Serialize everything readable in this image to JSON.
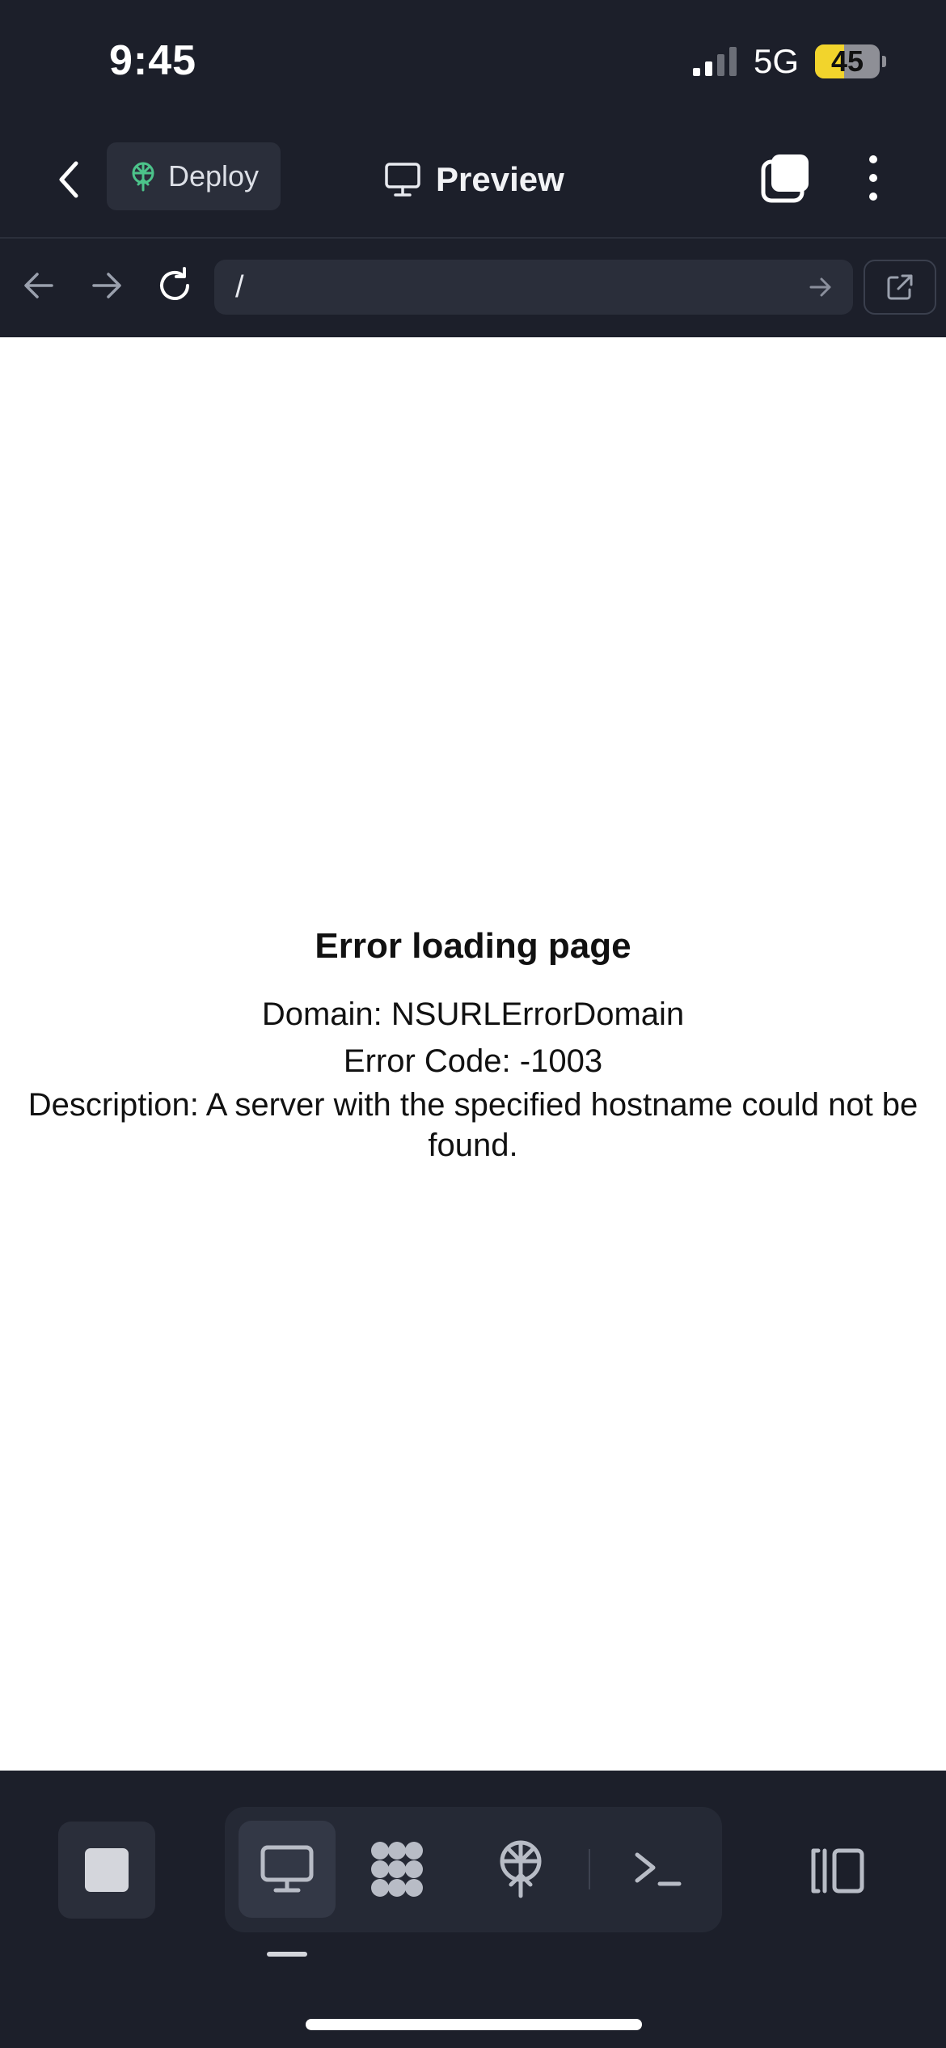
{
  "status_bar": {
    "time": "9:45",
    "network": "5G",
    "battery_percent": 45,
    "battery_label": "45"
  },
  "nav": {
    "deploy_label": "Deploy",
    "title": "Preview"
  },
  "url_bar": {
    "value": "/"
  },
  "content": {
    "error_title": "Error loading page",
    "domain_line": "Domain: NSURLErrorDomain",
    "code_line": "Error Code: -1003",
    "description_line": "Description: A server with the specified hostname could not be found."
  },
  "toolbar": {
    "active_tool": "preview",
    "tools": [
      "preview",
      "workflows",
      "deploy",
      "shell"
    ]
  },
  "colors": {
    "background": "#1c1f2a",
    "surface": "#2a2e3a",
    "deploy_accent": "#4cc38a",
    "battery": "#f2d42c"
  }
}
